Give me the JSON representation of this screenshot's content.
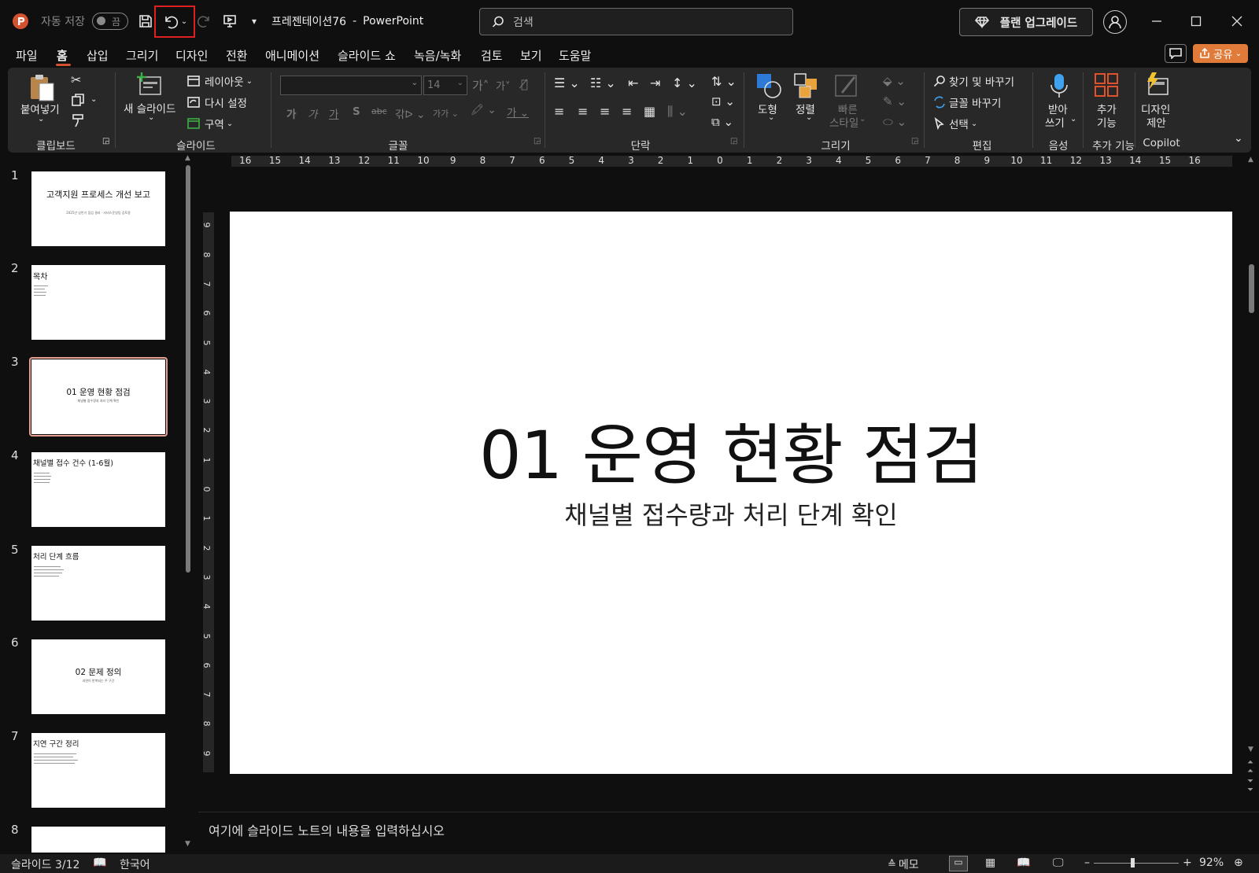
{
  "titlebar": {
    "autosave_label": "자동 저장",
    "autosave_state": "끔",
    "filename": "프레젠테이션76",
    "separator": "-",
    "app_name": "PowerPoint",
    "search_placeholder": "검색",
    "upgrade_label": "플랜 업그레이드"
  },
  "tabs": [
    "파일",
    "홈",
    "삽입",
    "그리기",
    "디자인",
    "전환",
    "애니메이션",
    "슬라이드 쇼",
    "녹음/녹화",
    "검토",
    "보기",
    "도움말"
  ],
  "share_label": "공유",
  "ribbon": {
    "clipboard": {
      "paste": "붙여넣기",
      "label": "클립보드"
    },
    "slides": {
      "new_slide_line1": "새 슬라이드",
      "layout": "레이아웃",
      "reset": "다시 설정",
      "section": "구역",
      "label": "슬라이드"
    },
    "font": {
      "font_size": "14",
      "label": "글꼴"
    },
    "paragraph": {
      "label": "단락"
    },
    "drawing": {
      "shapes": "도형",
      "arrange": "정렬",
      "quick_styles_1": "빠른",
      "quick_styles_2": "스타일",
      "label": "그리기"
    },
    "editing": {
      "find_replace": "찾기 및 바꾸기",
      "replace_font": "글꼴 바꾸기",
      "select": "선택",
      "label": "편집"
    },
    "voice": {
      "dictate_1": "받아",
      "dictate_2": "쓰기",
      "label": "음성"
    },
    "addins": {
      "addins_1": "추가",
      "addins_2": "기능",
      "label": "추가 기능"
    },
    "copilot": {
      "designer_1": "디자인",
      "designer_2": "제안",
      "label": "Copilot"
    }
  },
  "ruler_h": [
    "16",
    "15",
    "14",
    "13",
    "12",
    "11",
    "10",
    "9",
    "8",
    "7",
    "6",
    "5",
    "4",
    "3",
    "2",
    "1",
    "0",
    "1",
    "2",
    "3",
    "4",
    "5",
    "6",
    "7",
    "8",
    "9",
    "10",
    "11",
    "12",
    "13",
    "14",
    "15",
    "16"
  ],
  "ruler_v": [
    "9",
    "8",
    "7",
    "6",
    "5",
    "4",
    "3",
    "2",
    "1",
    "0",
    "1",
    "2",
    "3",
    "4",
    "5",
    "6",
    "7",
    "8",
    "9"
  ],
  "slides": [
    {
      "num": "1",
      "title": "고객지원 프로세스 개선 보고",
      "subtitle": "2025년 상반기 점검 결과 · 서비스운영팀 검토용"
    },
    {
      "num": "2",
      "title": "목차"
    },
    {
      "num": "3",
      "title": "01 운영 현황 점검",
      "subtitle": "채널별 접수량과 처리 단계 확인"
    },
    {
      "num": "4",
      "title": "채널별 접수 건수 (1-6월)"
    },
    {
      "num": "5",
      "title": "처리 단계 흐름"
    },
    {
      "num": "6",
      "title": "02 문제 정의",
      "subtitle": "지연이 반복되는 주 구간"
    },
    {
      "num": "7",
      "title": "지연 구간 정리"
    },
    {
      "num": "8",
      "title": ""
    }
  ],
  "current_slide": {
    "title": "01 운영 현황 점검",
    "subtitle": "채널별 접수량과 처리 단계 확인"
  },
  "notes_placeholder": "여기에 슬라이드 노트의 내용을 입력하십시오",
  "status": {
    "slide_counter": "슬라이드 3/12",
    "language": "한국어",
    "notes": "메모",
    "zoom": "92%"
  },
  "colors": {
    "accent": "#d35230",
    "share_bg": "#e07b39",
    "undo_highlight": "#e02020"
  }
}
